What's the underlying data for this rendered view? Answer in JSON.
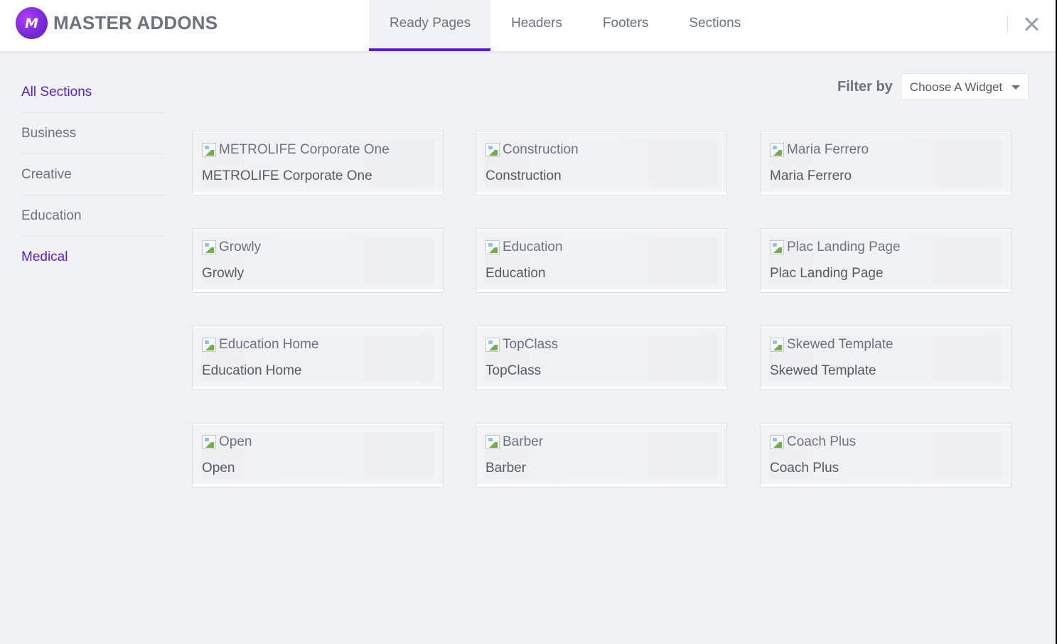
{
  "logo": {
    "mark": "M",
    "text": "MASTER ADDONS"
  },
  "tabs": [
    {
      "label": "Ready Pages",
      "active": true
    },
    {
      "label": "Headers",
      "active": false
    },
    {
      "label": "Footers",
      "active": false
    },
    {
      "label": "Sections",
      "active": false
    }
  ],
  "close_icon": "close-icon",
  "sidebar": {
    "items": [
      {
        "label": "All Sections",
        "selected": true
      },
      {
        "label": "Business",
        "selected": false
      },
      {
        "label": "Creative",
        "selected": false
      },
      {
        "label": "Education",
        "selected": false
      },
      {
        "label": "Medical",
        "selected": true
      }
    ]
  },
  "filter": {
    "label": "Filter by",
    "selected": "Choose A Widget"
  },
  "templates": [
    {
      "thumb_alt": "METROLIFE Corporate One",
      "title": "METROLIFE Corporate One"
    },
    {
      "thumb_alt": "Construction",
      "title": "Construction"
    },
    {
      "thumb_alt": "Maria Ferrero",
      "title": "Maria Ferrero"
    },
    {
      "thumb_alt": "Growly",
      "title": "Growly"
    },
    {
      "thumb_alt": "Education",
      "title": "Education"
    },
    {
      "thumb_alt": "Plac Landing Page",
      "title": "Plac Landing Page"
    },
    {
      "thumb_alt": "Education Home",
      "title": "Education Home"
    },
    {
      "thumb_alt": "TopClass",
      "title": "TopClass"
    },
    {
      "thumb_alt": "Skewed Template",
      "title": "Skewed Template"
    },
    {
      "thumb_alt": "Open",
      "title": "Open"
    },
    {
      "thumb_alt": "Barber",
      "title": "Barber"
    },
    {
      "thumb_alt": "Coach Plus",
      "title": "Coach Plus"
    }
  ],
  "colors": {
    "accent": "#5a1ad6",
    "text_muted": "#6d7280",
    "background": "#f1f2f4"
  }
}
